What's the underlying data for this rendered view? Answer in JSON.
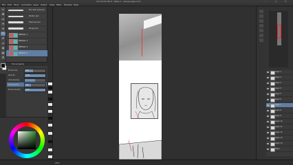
{
  "window": {
    "title": "Clip Studio Paint - [Page 1 - manga page.cmc]",
    "controls": [
      "–",
      "□",
      "✕"
    ]
  },
  "menu": [
    "File",
    "Edit",
    "Story",
    "Animation",
    "Layer",
    "Select",
    "View",
    "Filter",
    "Window",
    "Help"
  ],
  "tools": [
    {
      "icon": "magnifier-icon",
      "glyph": "⌕"
    },
    {
      "icon": "move-icon",
      "glyph": "✥"
    },
    {
      "icon": "selection-icon",
      "glyph": "▭"
    },
    {
      "icon": "wand-icon",
      "glyph": "✦"
    },
    {
      "icon": "eyedropper-icon",
      "glyph": "⌖"
    },
    {
      "icon": "pen-icon",
      "glyph": "✎",
      "selected": true
    },
    {
      "icon": "brush-icon",
      "glyph": "✐"
    },
    {
      "icon": "eraser-icon",
      "glyph": "▱"
    },
    {
      "icon": "fill-icon",
      "glyph": "◈"
    },
    {
      "icon": "gradient-icon",
      "glyph": "▤"
    },
    {
      "icon": "text-icon",
      "glyph": "A"
    },
    {
      "icon": "hand-icon",
      "glyph": "✋"
    }
  ],
  "subtools": [
    {
      "label": "Pen with pressure",
      "style": "thin"
    },
    {
      "label": "Marker pen",
      "style": "thin"
    },
    {
      "label": "Textured pen",
      "style": "thick"
    },
    {
      "label": "Rough pen",
      "style": "thick"
    },
    {
      "label": "SPECIAL 1",
      "style": "swatch"
    },
    {
      "label": "SPECIAL 2",
      "style": "swatch"
    },
    {
      "label": "SPECIAL 3",
      "style": "swatch"
    },
    {
      "label": "SPECIAL 4",
      "style": "swatch",
      "selected": true
    }
  ],
  "tool_property": {
    "header": "Tool property",
    "rows": [
      {
        "label": "Brush size",
        "value": "8.0",
        "level": 0.4
      },
      {
        "label": "Opacity",
        "value": "100",
        "level": 1.0
      },
      {
        "label": "Anti-aliasing",
        "value": "",
        "level": 0.5
      },
      {
        "label": "Stabilization",
        "value": "12",
        "level": 0.3,
        "selected": true
      },
      {
        "label": "Brush density",
        "value": "100",
        "level": 1.0
      }
    ]
  },
  "layers": [
    {
      "name": "Layer 1"
    },
    {
      "name": "Layer 2"
    },
    {
      "name": "Layer 3"
    },
    {
      "name": "Layer 4"
    },
    {
      "name": "Layer 5"
    },
    {
      "name": "Layer 6"
    },
    {
      "name": "Layer 7",
      "selected": true
    },
    {
      "name": "Layer 8"
    },
    {
      "name": "Layer 9"
    },
    {
      "name": "Layer 10"
    },
    {
      "name": "Layer 11"
    },
    {
      "name": "Layer 12"
    },
    {
      "name": "Layer 13"
    },
    {
      "name": "Layer 14"
    },
    {
      "name": "Paper"
    }
  ],
  "status": {
    "zoom": "25.0"
  },
  "colors": {
    "main": "#111111",
    "sub": "#ffffff",
    "accent": "#5f7fa3"
  }
}
